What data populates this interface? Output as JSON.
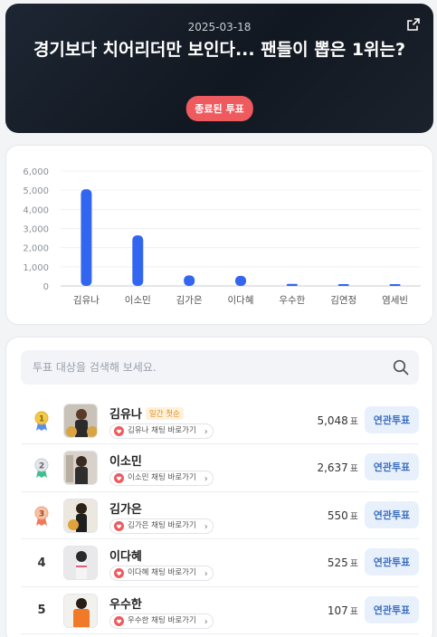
{
  "hero": {
    "date": "2025-03-18",
    "title": "경기보다 치어리더만 보인다... 팬들이 뽑은 1위는?",
    "status_badge": "종료된 투표",
    "share_icon": "share-icon"
  },
  "chart_data": {
    "type": "bar",
    "categories": [
      "김유나",
      "이소민",
      "김가은",
      "이다혜",
      "우수한",
      "김연정",
      "염세빈"
    ],
    "values": [
      5048,
      2637,
      550,
      525,
      107,
      60,
      40
    ],
    "yticks": [
      "6,000",
      "5,000",
      "4,000",
      "3,000",
      "2,000",
      "1,000",
      "0"
    ],
    "ylim": [
      0,
      6000
    ],
    "bar_color": "#3366f0",
    "grid": true
  },
  "search": {
    "placeholder": "투표 대상을 검색해 보세요.",
    "value": ""
  },
  "list": {
    "rows": [
      {
        "rank": "1",
        "medal": "gold-medal-icon",
        "name": "김유나",
        "tag": "일간 첫순",
        "chat": "김유나 채팅 바로가기",
        "votes": "5,048",
        "unit": "표",
        "button": "연관투표"
      },
      {
        "rank": "2",
        "medal": "silver-medal-icon",
        "name": "이소민",
        "tag": "",
        "chat": "이소민 채팅 바로가기",
        "votes": "2,637",
        "unit": "표",
        "button": "연관투표"
      },
      {
        "rank": "3",
        "medal": "bronze-medal-icon",
        "name": "김가은",
        "tag": "",
        "chat": "김가은 채팅 바로가기",
        "votes": "550",
        "unit": "표",
        "button": "연관투표"
      },
      {
        "rank": "4",
        "medal": "",
        "name": "이다혜",
        "tag": "",
        "chat": "이다혜 채팅 바로가기",
        "votes": "525",
        "unit": "표",
        "button": "연관투표"
      },
      {
        "rank": "5",
        "medal": "",
        "name": "우수한",
        "tag": "",
        "chat": "우수한 채팅 바로가기",
        "votes": "107",
        "unit": "표",
        "button": "연관투표"
      }
    ]
  },
  "colors": {
    "accent_red": "#ef5a5f",
    "button_bg": "#e8f0fc",
    "button_text": "#3c6fc2",
    "gold": "#f2c94c",
    "silver": "#c7cbd1",
    "bronze": "#f2a07b"
  }
}
